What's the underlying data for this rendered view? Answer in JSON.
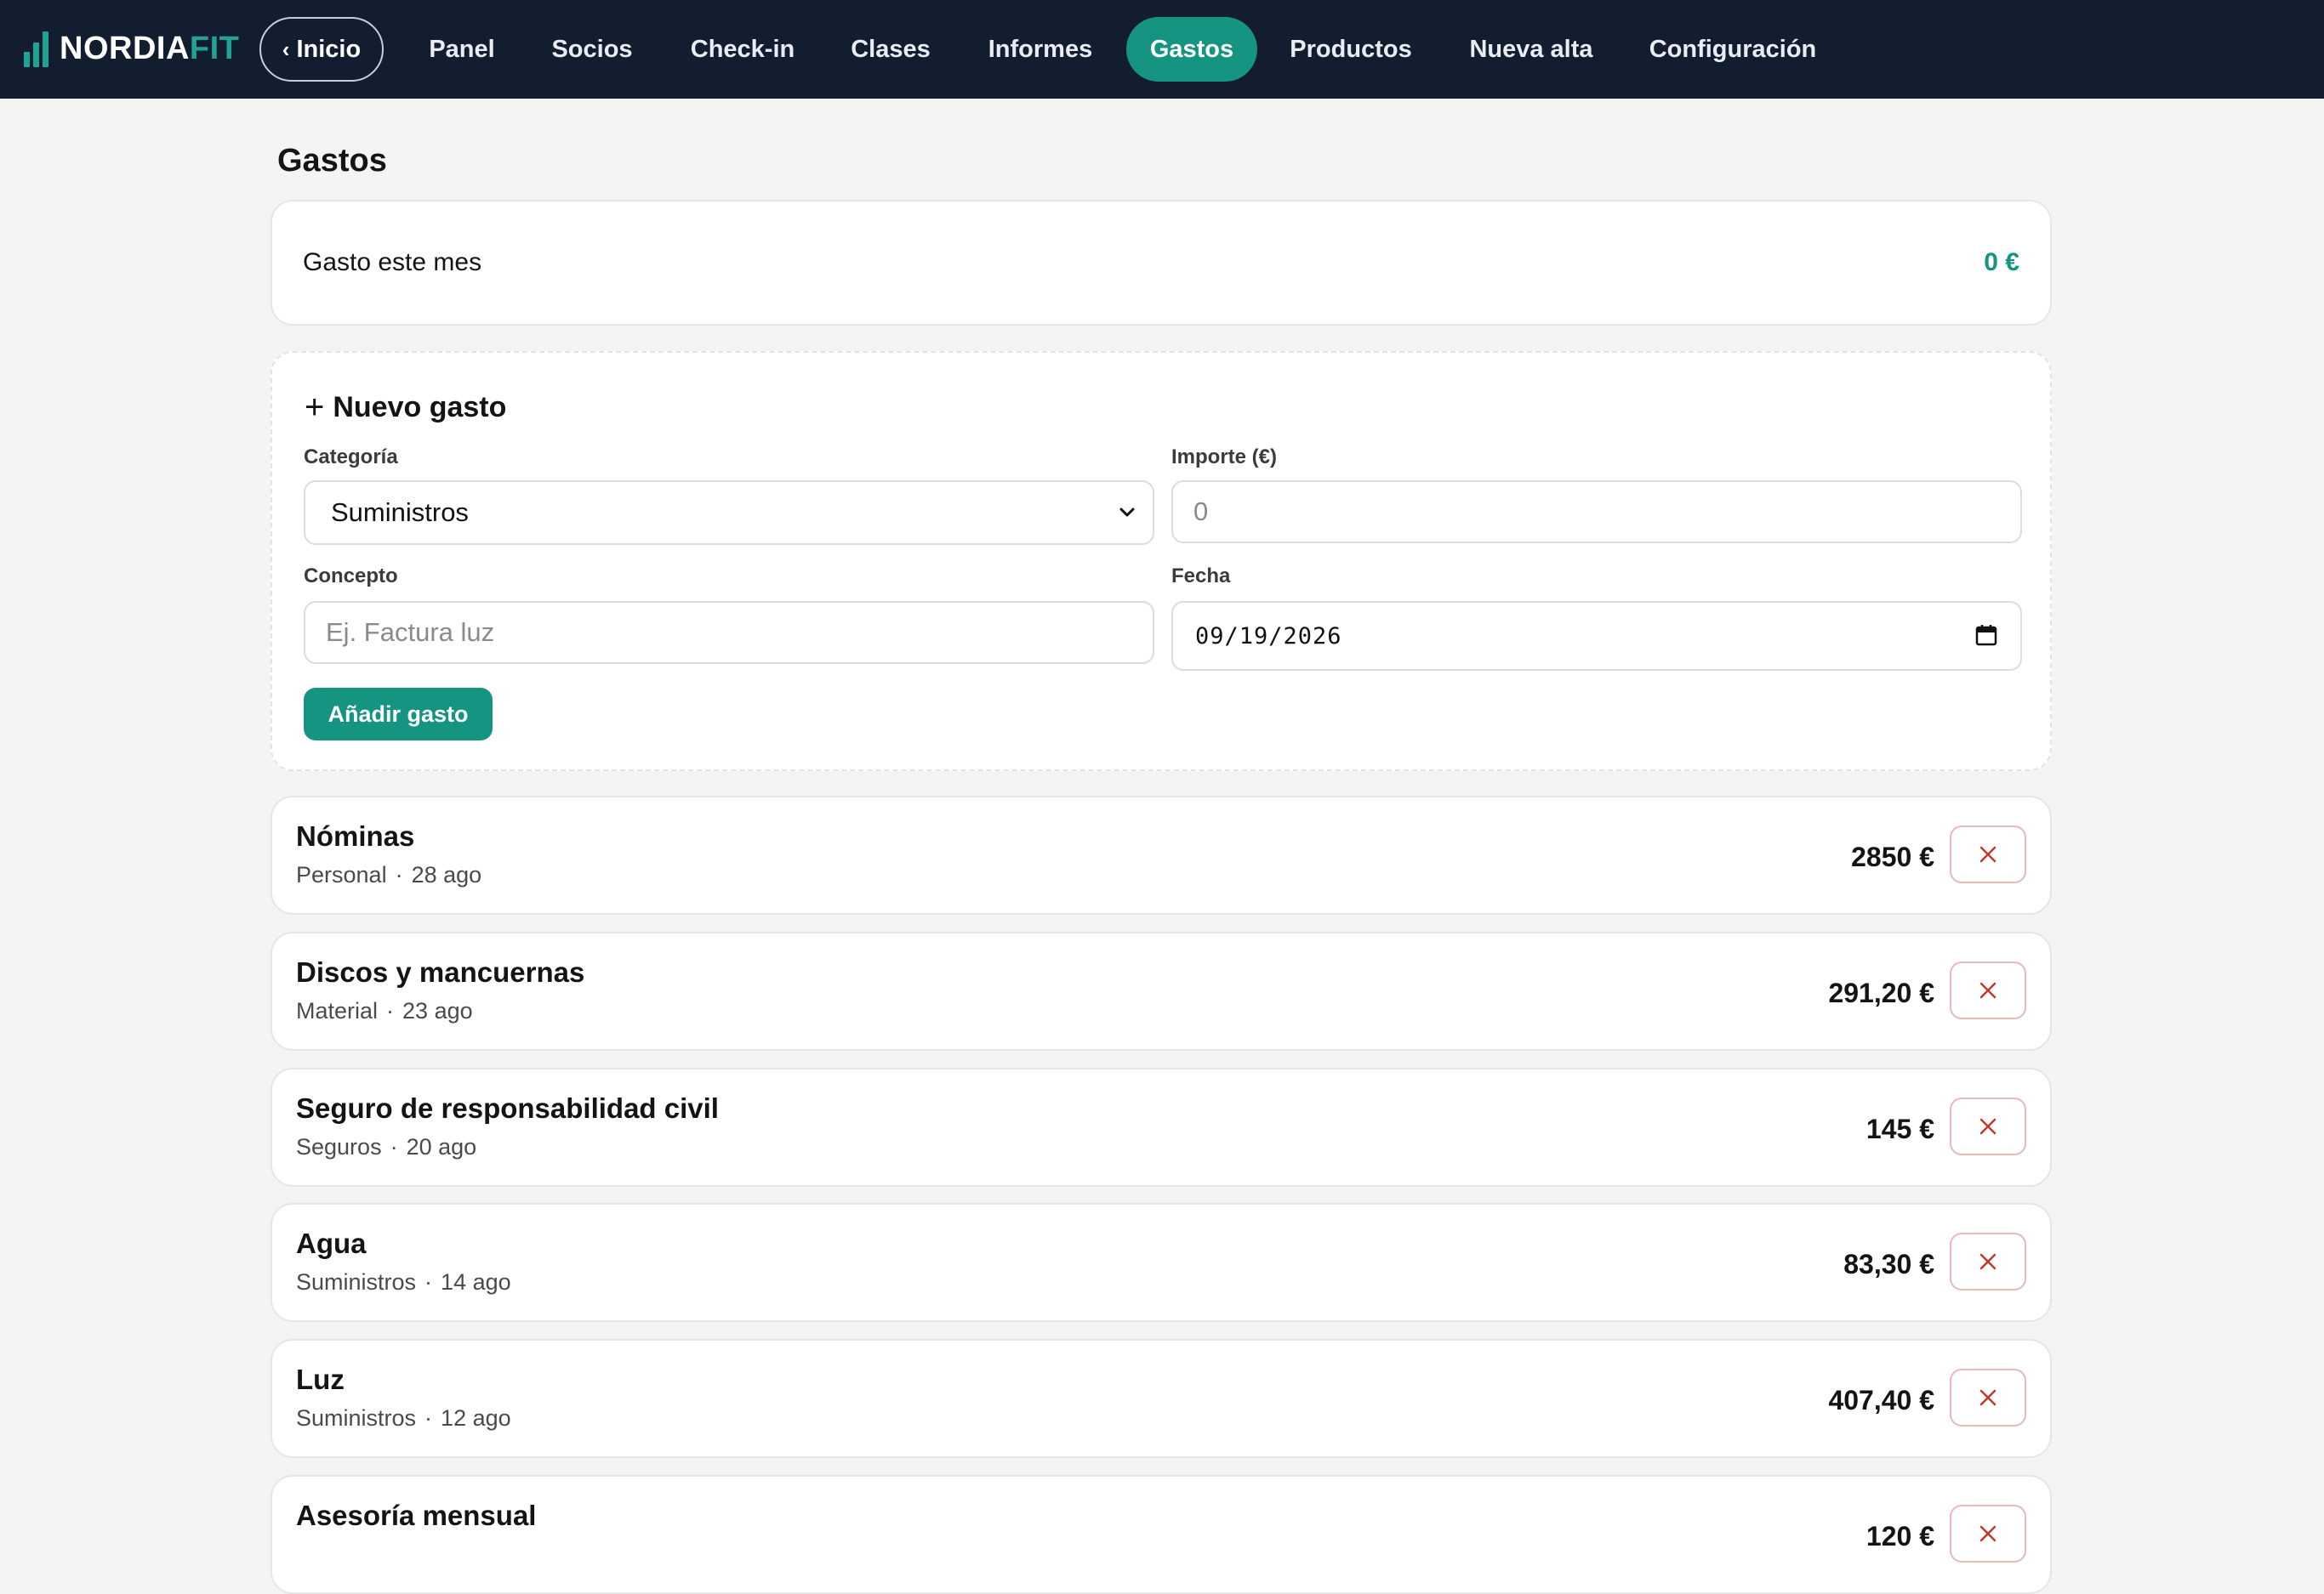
{
  "brand": {
    "part1": "NORDIA",
    "part2": "FIT"
  },
  "nav": {
    "home": "Inicio",
    "items": [
      "Panel",
      "Socios",
      "Check-in",
      "Clases",
      "Informes",
      "Gastos",
      "Productos",
      "Nueva alta",
      "Configuración"
    ],
    "active": "Gastos"
  },
  "page": {
    "title": "Gastos"
  },
  "summary": {
    "label": "Gasto este mes",
    "value": "0 €"
  },
  "form": {
    "title": "Nuevo gasto",
    "category_label": "Categoría",
    "category_value": "Suministros",
    "amount_label": "Importe (€)",
    "amount_placeholder": "0",
    "concept_label": "Concepto",
    "concept_placeholder": "Ej. Factura luz",
    "date_label": "Fecha",
    "date_value": "09/19/2026",
    "submit_label": "Añadir gasto"
  },
  "expenses": [
    {
      "name": "Nóminas",
      "category": "Personal",
      "date": "28 ago",
      "amount": "2850 €"
    },
    {
      "name": "Discos y mancuernas",
      "category": "Material",
      "date": "23 ago",
      "amount": "291,20 €"
    },
    {
      "name": "Seguro de responsabilidad civil",
      "category": "Seguros",
      "date": "20 ago",
      "amount": "145 €"
    },
    {
      "name": "Agua",
      "category": "Suministros",
      "date": "14 ago",
      "amount": "83,30 €"
    },
    {
      "name": "Luz",
      "category": "Suministros",
      "date": "12 ago",
      "amount": "407,40 €"
    },
    {
      "name": "Asesoría mensual",
      "category": "",
      "date": "",
      "amount": "120 €"
    }
  ],
  "colors": {
    "topbar": "#121e30",
    "accent": "#159482",
    "delete": "#c0392b",
    "background": "#f4f4f3"
  }
}
